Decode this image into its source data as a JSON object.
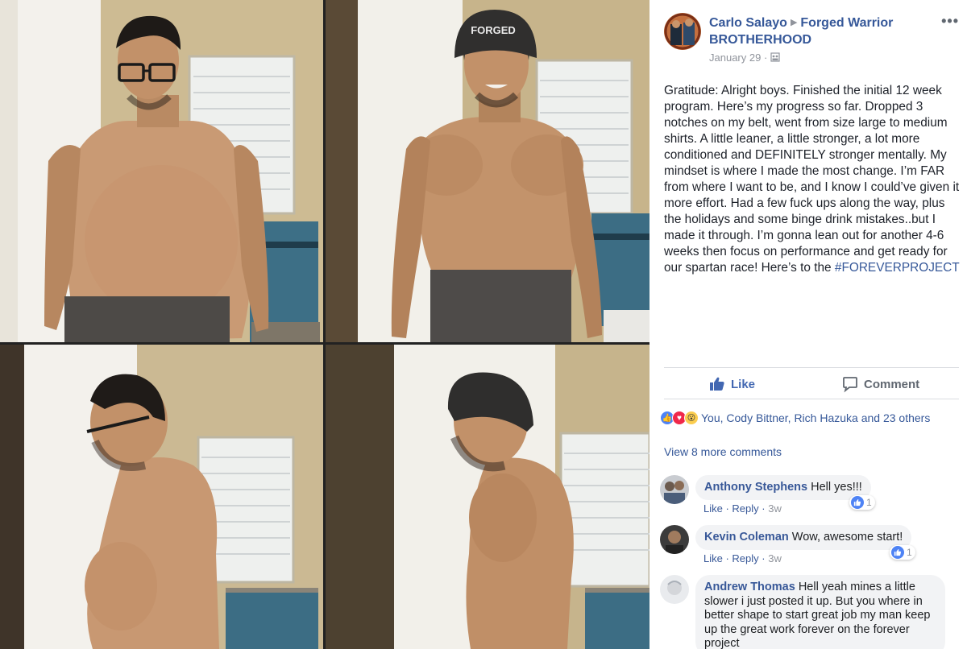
{
  "post": {
    "author": "Carlo Salayo",
    "group": "Forged Warrior BROTHERHOOD",
    "date": "January 29",
    "date_separator": "·",
    "more_label": "•••",
    "text_main": "Gratitude: Alright boys. Finished the initial 12 week program. Here’s my progress so far. Dropped 3 notches on my belt, went from size large to medium shirts. A little leaner, a little stronger, a lot more conditioned and DEFINITELY stronger mentally. My mindset is where I made the most change. I’m FAR from where I want to be, and I know I could’ve given it more effort. Had a few fuck ups along the way, plus the holidays and some binge drink mistakes..but I made it through. I’m gonna lean out for another 4-6 weeks then focus on performance and get ready for our spartan race! Here’s to the ",
    "hashtag": "#FOREVERPROJECT",
    "beanie_text": "FORGED"
  },
  "actions": {
    "like": "Like",
    "comment": "Comment"
  },
  "reactions": {
    "summary": "You, Cody Bittner, Rich Hazuka and 23 others"
  },
  "comments": {
    "view_more": "View 8 more comments",
    "items": [
      {
        "name": "Anthony Stephens",
        "text": "Hell yes!!!",
        "like": "Like",
        "reply": "Reply",
        "time": "3w",
        "likes": "1"
      },
      {
        "name": "Kevin Coleman",
        "text": "Wow, awesome start!",
        "like": "Like",
        "reply": "Reply",
        "time": "3w",
        "likes": "1"
      },
      {
        "name": "Andrew Thomas",
        "text": "Hell yeah mines a little slower i just posted it up. But you where in better shape to start great job my man keep up the great work forever on the forever project"
      }
    ]
  },
  "colors": {
    "link": "#365899",
    "like_blue": "#4267b2",
    "muted": "#90949c",
    "bubble": "#f2f3f5"
  }
}
